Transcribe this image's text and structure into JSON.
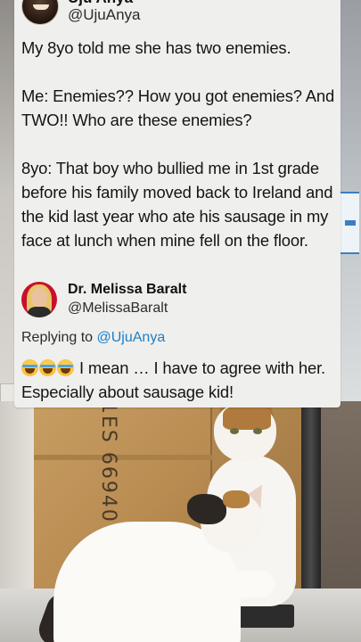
{
  "post": {
    "author_name": "Uju Anya",
    "author_handle": "@UjuAnya",
    "text": "My 8yo told me she has two enemies.\n\nMe: Enemies?? How you got enemies? And TWO!! Who are these enemies?\n\n8yo: That boy who bullied me in 1st grade before his family moved back to Ireland and the kid last year who ate his sausage in my face at lunch when mine fell on the floor."
  },
  "reply": {
    "author_name": "Dr. Melissa Baralt",
    "author_handle": "@MelissaBaralt",
    "replying_to_label": "Replying to",
    "replying_to_handle": "@UjuAnya",
    "emoji": "face-with-tears-of-joy-icon",
    "text": "I mean … I have to agree with her. Especially about sausage kid!"
  },
  "colors": {
    "card_background": "#efefed",
    "link": "#1d7fc7",
    "text": "#141414"
  },
  "background_photo": {
    "box_print": "1ES 66940"
  }
}
